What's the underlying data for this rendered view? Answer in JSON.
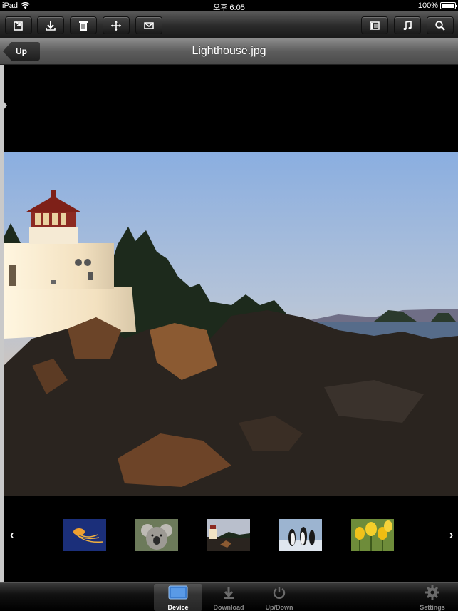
{
  "status": {
    "device": "iPad",
    "time": "오후 6:05",
    "battery": "100%"
  },
  "toolbar": {
    "left_icons": [
      "import-icon",
      "download-icon",
      "trash-icon",
      "move-icon",
      "mail-icon"
    ],
    "right_icons": [
      "list-view-icon",
      "music-icon",
      "search-icon"
    ]
  },
  "nav": {
    "back_label": "Up",
    "title": "Lighthouse.jpg"
  },
  "gallery": {
    "prev": "‹",
    "next": "›",
    "thumbnails": [
      "jellyfish",
      "koala",
      "lighthouse",
      "penguins",
      "tulips"
    ]
  },
  "tabs": [
    {
      "label": "Device",
      "icon": "device-icon",
      "active": true
    },
    {
      "label": "Download",
      "icon": "download-icon",
      "active": false
    },
    {
      "label": "Up/Down",
      "icon": "power-icon",
      "active": false
    },
    {
      "label": "Settings",
      "icon": "gear-icon",
      "active": false
    }
  ],
  "colors": {
    "tab_active": "#ffffff",
    "tab_inactive": "#8a8a8a",
    "edge": "#c9c9c9"
  }
}
